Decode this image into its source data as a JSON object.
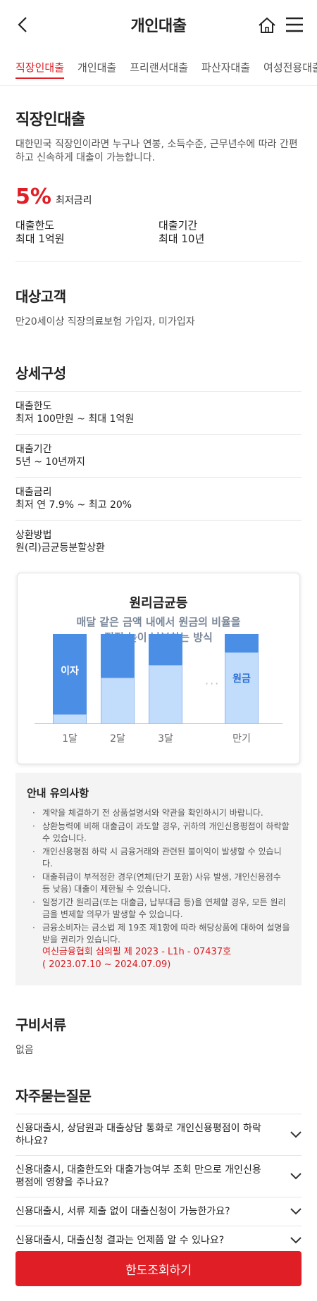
{
  "header": {
    "title": "개인대출"
  },
  "tabs": [
    {
      "label": "직장인대출",
      "active": true
    },
    {
      "label": "개인대출",
      "active": false
    },
    {
      "label": "프리랜서대출",
      "active": false
    },
    {
      "label": "파산자대출",
      "active": false
    },
    {
      "label": "여성전용대출",
      "active": false
    }
  ],
  "product": {
    "title": "직장인대출",
    "description": "대한민국 직장인이라면 누구나 연봉, 소득수준, 근무년수에 따라 간편하고 신속하게 대출이 가능합니다.",
    "rate_value": "5%",
    "rate_label": "최저금리",
    "limit_label": "대출한도",
    "limit_value": "최대 1억원",
    "period_label": "대출기간",
    "period_value": "최대 10년"
  },
  "target": {
    "title": "대상고객",
    "text": "만20세이상 직장의료보험 가입자, 미가입자"
  },
  "detail": {
    "title": "상세구성",
    "items": [
      {
        "label": "대출한도",
        "value": "최저 100만원 ~ 최대 1억원"
      },
      {
        "label": "대출기간",
        "value": "5년 ~ 10년까지"
      },
      {
        "label": "대출금리",
        "value": "최저 연 7.9% ~ 최고 20%"
      },
      {
        "label": "상환방법",
        "value": "원(리)금균등분할상환"
      }
    ]
  },
  "illustration": {
    "title": "원리금균등",
    "subtitle_line1": "매달 같은 금액 내에서 원금의 비율을",
    "subtitle_line2": "점점 높이 납부하는 방식",
    "interest_label": "이자",
    "principal_label": "원금",
    "x_labels": [
      "1달",
      "2달",
      "3달",
      "만기"
    ],
    "dots": "···"
  },
  "notice": {
    "title": "안내 유의사항",
    "items": [
      "계약을 체결하기 전 상품설명서와 약관을 확인하시기 바랍니다.",
      "상환능력에 비해 대출금이 과도할 경우, 귀하의 개인신용평점이 하락할 수 있습니다.",
      "개인신용평점 하락 시 금융거래와 관련된 불이익이 발생할 수 있습니다.",
      "대출취급이 부적정한 경우(연체(단기 포함) 사유 발생, 개인신용점수 등 낮음) 대출이 제한될 수 있습니다.",
      "일정기간 원리금(또는 대출금, 납부대금 등)을 연체할 경우, 모든 원리금을 변제할 의무가 발생할 수 있습니다.",
      "금융소비자는 금소법 제 19조 제1항에 따라 해당상품에 대하여 설명을 받을 권리가 있습니다."
    ],
    "review_line1": "여신금융협회 심의필 제 2023 - L1h - 07437호",
    "review_line2": "( 2023.07.10 ~ 2024.07.09)"
  },
  "documents": {
    "title": "구비서류",
    "text": "없음"
  },
  "faq": {
    "title": "자주묻는질문",
    "items": [
      "신용대출시, 상담원과 대출상담 통화로 개인신용평점이 하락하나요?",
      "신용대출시, 대출한도와 대출가능여부 조회 만으로 개인신용평점에 영향을 주나요?",
      "신용대출시, 서류 제출 없이 대출신청이 가능한가요?",
      "신용대출시, 대출신청 결과는 언제쯤 알 수 있나요?"
    ]
  },
  "cta": {
    "label": "한도조회하기"
  },
  "colors": {
    "accent": "#e01e25",
    "bar_dark": "#4b8ee6",
    "bar_light": "#c2dcfb"
  },
  "icons": [
    "back-arrow-icon",
    "home-icon",
    "menu-icon",
    "chevron-down-icon"
  ]
}
